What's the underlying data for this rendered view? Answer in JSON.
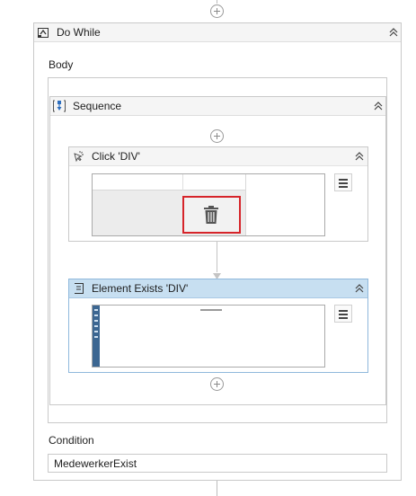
{
  "do_while": {
    "title": "Do While",
    "body_label": "Body",
    "condition_label": "Condition",
    "condition_value": "MedewerkerExist"
  },
  "sequence": {
    "title": "Sequence"
  },
  "click_activity": {
    "title": "Click 'DIV'"
  },
  "element_exists": {
    "title": "Element Exists 'DIV'"
  },
  "colors": {
    "header_selected": "#c7dff1",
    "selection_border": "#d6242a",
    "panel_border": "#c9c9c9",
    "header_bg": "#f5f5f5"
  },
  "icons": [
    "add-activity-icon",
    "do-while-icon",
    "collapse-icon",
    "sequence-icon",
    "click-icon",
    "element-exists-icon",
    "delete-icon",
    "menu-icon"
  ]
}
